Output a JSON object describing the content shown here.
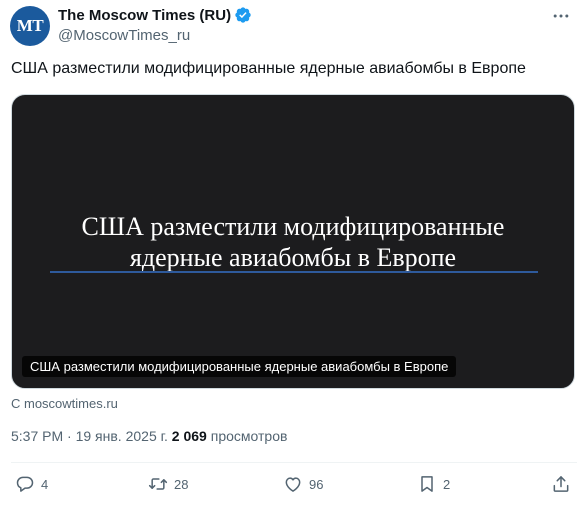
{
  "author": {
    "avatar_text": "MT",
    "display_name": "The Moscow Times (RU)",
    "handle": "@MoscowTimes_ru"
  },
  "tweet": {
    "text": "США разместили модифицированные ядерные авиабомбы в Европе"
  },
  "card": {
    "headline_line1": "США разместили модифицированные",
    "headline_line2": "ядерные авиабомбы в Европе",
    "caption": "США разместили модифицированные ядерные авиабомбы в Европе",
    "source": "С moscowtimes.ru"
  },
  "meta": {
    "time": "5:37 PM",
    "separator": "·",
    "date": "19 янв. 2025 г.",
    "views_count": "2 069",
    "views_label": "просмотров"
  },
  "actions": {
    "replies": "4",
    "reposts": "28",
    "likes": "96",
    "bookmarks": "2"
  },
  "colors": {
    "avatar_bg": "#1b5a9d",
    "verified": "#1d9bf0",
    "secondary_text": "#536471",
    "card_bg": "#1c1c1e",
    "card_rule": "#2e5a9c"
  },
  "icons": [
    "verified-badge-icon",
    "more-icon",
    "reply-icon",
    "repost-icon",
    "like-icon",
    "bookmark-icon",
    "share-icon"
  ]
}
